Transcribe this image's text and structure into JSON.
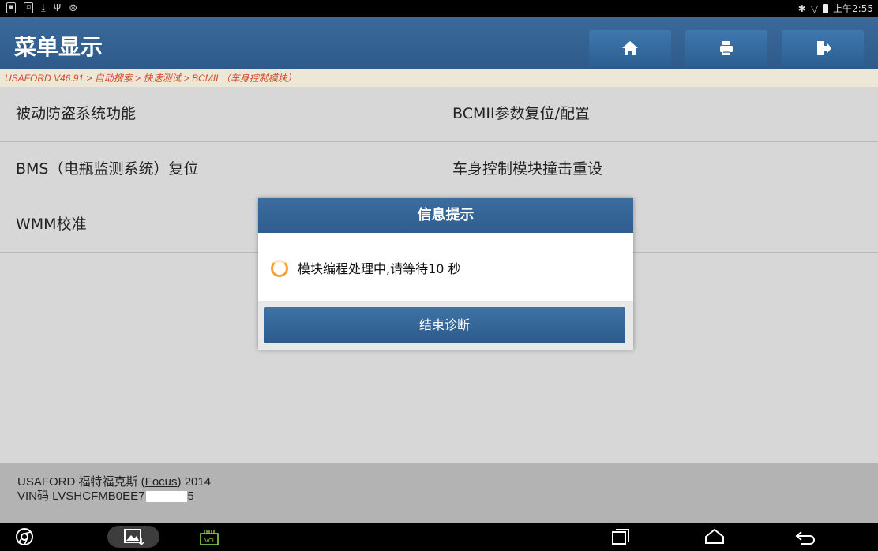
{
  "status_bar": {
    "left_icons": [
      "notification-icon",
      "image-icon",
      "download-icon",
      "usb-icon",
      "android-debug-icon"
    ],
    "time": "上午2:55"
  },
  "header": {
    "title": "菜单显示",
    "buttons": [
      "home-icon",
      "print-icon",
      "exit-icon"
    ]
  },
  "breadcrumb": "USAFORD V46.91 > 自动搜索 > 快速测试 > BCMII （车身控制模块）",
  "menu": {
    "rows": [
      {
        "left": "被动防盗系统功能",
        "right": "BCMII参数复位/配置"
      },
      {
        "left": "BMS（电瓶监测系统）复位",
        "right": "车身控制模块撞击重设"
      },
      {
        "left": "WMM校准",
        "right": ""
      }
    ]
  },
  "footer": {
    "line1_prefix": "USAFORD 福特福克斯 (",
    "line1_model": "Focus",
    "line1_suffix": ") 2014",
    "vin_prefix": "VIN码 LVSHCFMB0EE7",
    "vin_suffix": "5"
  },
  "dialog": {
    "title": "信息提示",
    "message": "模块编程处理中,请等待10 秒",
    "button": "结束诊断"
  },
  "colors": {
    "header_blue": "#2d5a8a",
    "breadcrumb_text": "#d44a2a",
    "spinner": "#f7a23a"
  }
}
